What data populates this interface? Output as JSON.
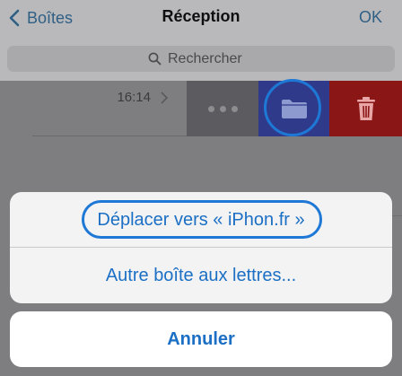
{
  "header": {
    "back_label": "Boîtes",
    "title": "Réception",
    "ok_label": "OK"
  },
  "search": {
    "placeholder": "Rechercher"
  },
  "mail_row": {
    "time": "16:14"
  },
  "swipe_actions": {
    "more_icon": "ellipsis-icon",
    "move_icon": "folder-icon",
    "trash_icon": "trash-icon",
    "move_color": "#2f3b8a",
    "trash_color": "#8a1616"
  },
  "action_sheet": {
    "move_to_label": "Déplacer vers « iPhon.fr »",
    "other_mailbox_label": "Autre boîte aux lettres...",
    "cancel_label": "Annuler"
  },
  "colors": {
    "accent": "#1b6fc4",
    "highlight_ring": "#1e78d6"
  }
}
